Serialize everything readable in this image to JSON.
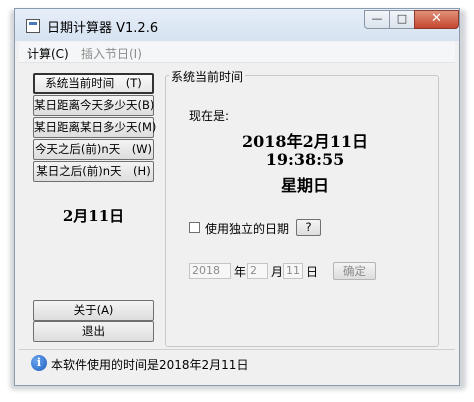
{
  "window": {
    "title": "日期计算器 V1.2.6"
  },
  "titlebar_buttons": {
    "minimize": "—",
    "maximize": "□",
    "close": "✕"
  },
  "menu": [
    {
      "label": "计算(C)",
      "enabled": true
    },
    {
      "label": "插入节日(I)",
      "enabled": false
    }
  ],
  "left_buttons": [
    {
      "label": "系统当前时间　(T)",
      "active": true
    },
    {
      "label": "某日距离今天多少天(B)",
      "active": false
    },
    {
      "label": "某日距离某日多少天(M)",
      "active": false
    },
    {
      "label": "今天之后(前)n天　(W)",
      "active": false
    },
    {
      "label": "某日之后(前)n天　(H)",
      "active": false
    }
  ],
  "left_date": "2月11日",
  "bottom_buttons": {
    "about": "关于(A)",
    "exit": "退出"
  },
  "group": {
    "title": "系统当前时间",
    "now_label": "现在是:",
    "date": "2018年2月11日",
    "time": "19:38:55",
    "weekday": "星期日",
    "use_independent_date_label": "使用独立的日期",
    "use_independent_date_checked": false,
    "help_label": "?",
    "year_value": "2018",
    "year_unit": "年",
    "month_value": "2",
    "month_unit": "月",
    "day_value": "11",
    "day_unit": "日",
    "confirm_label": "确定"
  },
  "status": {
    "icon": "info-icon",
    "text": "本软件使用的时间是2018年2月11日"
  }
}
